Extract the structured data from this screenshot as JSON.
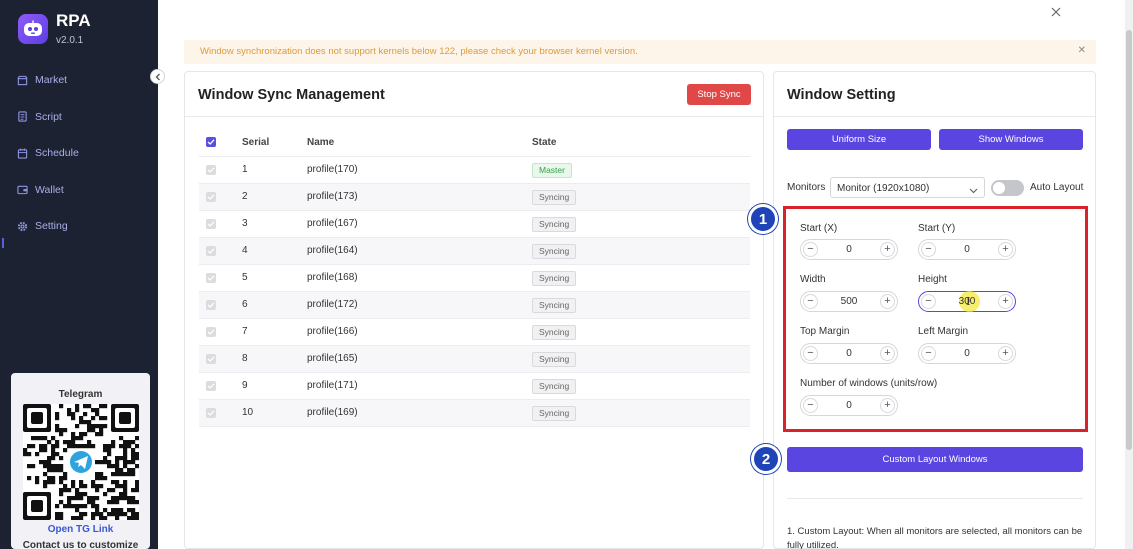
{
  "app": {
    "name": "RPA",
    "version": "v2.0.1"
  },
  "sidebar": {
    "items": [
      {
        "label": "Market",
        "icon": "store-icon"
      },
      {
        "label": "Script",
        "icon": "script-icon"
      },
      {
        "label": "Schedule",
        "icon": "calendar-icon"
      },
      {
        "label": "Wallet",
        "icon": "wallet-icon"
      },
      {
        "label": "Setting",
        "icon": "gear-icon"
      }
    ],
    "telegram": {
      "title": "Telegram",
      "link": "Open TG Link",
      "contact": "Contact us to customize"
    }
  },
  "alert": {
    "text": "Window synchronization does not support kernels below 122, please check your browser kernel version."
  },
  "sync": {
    "title": "Window Sync Management",
    "stop_label": "Stop Sync",
    "columns": {
      "serial": "Serial",
      "name": "Name",
      "state": "State"
    },
    "rows": [
      {
        "serial": "1",
        "name": "profile(170)",
        "state": "Master"
      },
      {
        "serial": "2",
        "name": "profile(173)",
        "state": "Syncing"
      },
      {
        "serial": "3",
        "name": "profile(167)",
        "state": "Syncing"
      },
      {
        "serial": "4",
        "name": "profile(164)",
        "state": "Syncing"
      },
      {
        "serial": "5",
        "name": "profile(168)",
        "state": "Syncing"
      },
      {
        "serial": "6",
        "name": "profile(172)",
        "state": "Syncing"
      },
      {
        "serial": "7",
        "name": "profile(166)",
        "state": "Syncing"
      },
      {
        "serial": "8",
        "name": "profile(165)",
        "state": "Syncing"
      },
      {
        "serial": "9",
        "name": "profile(171)",
        "state": "Syncing"
      },
      {
        "serial": "10",
        "name": "profile(169)",
        "state": "Syncing"
      }
    ]
  },
  "setting": {
    "title": "Window Setting",
    "uniform_label": "Uniform Size",
    "show_label": "Show Windows",
    "monitors_label": "Monitors",
    "monitor_value": "Monitor (1920x1080)",
    "auto_layout_label": "Auto Layout",
    "fields": {
      "start_x": {
        "label": "Start   (X)",
        "value": "0"
      },
      "start_y": {
        "label": "Start (Y)",
        "value": "0"
      },
      "width": {
        "label": "Width",
        "value": "500"
      },
      "height": {
        "label": "Height",
        "value": "300"
      },
      "top_margin": {
        "label": "Top Margin",
        "value": "0"
      },
      "left_margin": {
        "label": "Left Margin",
        "value": "0"
      },
      "num_windows": {
        "label": "Number of windows (units/row)",
        "value": "0"
      }
    },
    "custom_layout_label": "Custom Layout Windows",
    "note": "1. Custom Layout: When all monitors are selected, all monitors can be fully utilized."
  },
  "markers": {
    "one": "1",
    "two": "2"
  },
  "colors": {
    "accent": "#5b45e0",
    "danger": "#e04848",
    "sidebar": "#1d2233",
    "alert_text": "#dd9a3a",
    "highlight_box": "#d8232a"
  }
}
